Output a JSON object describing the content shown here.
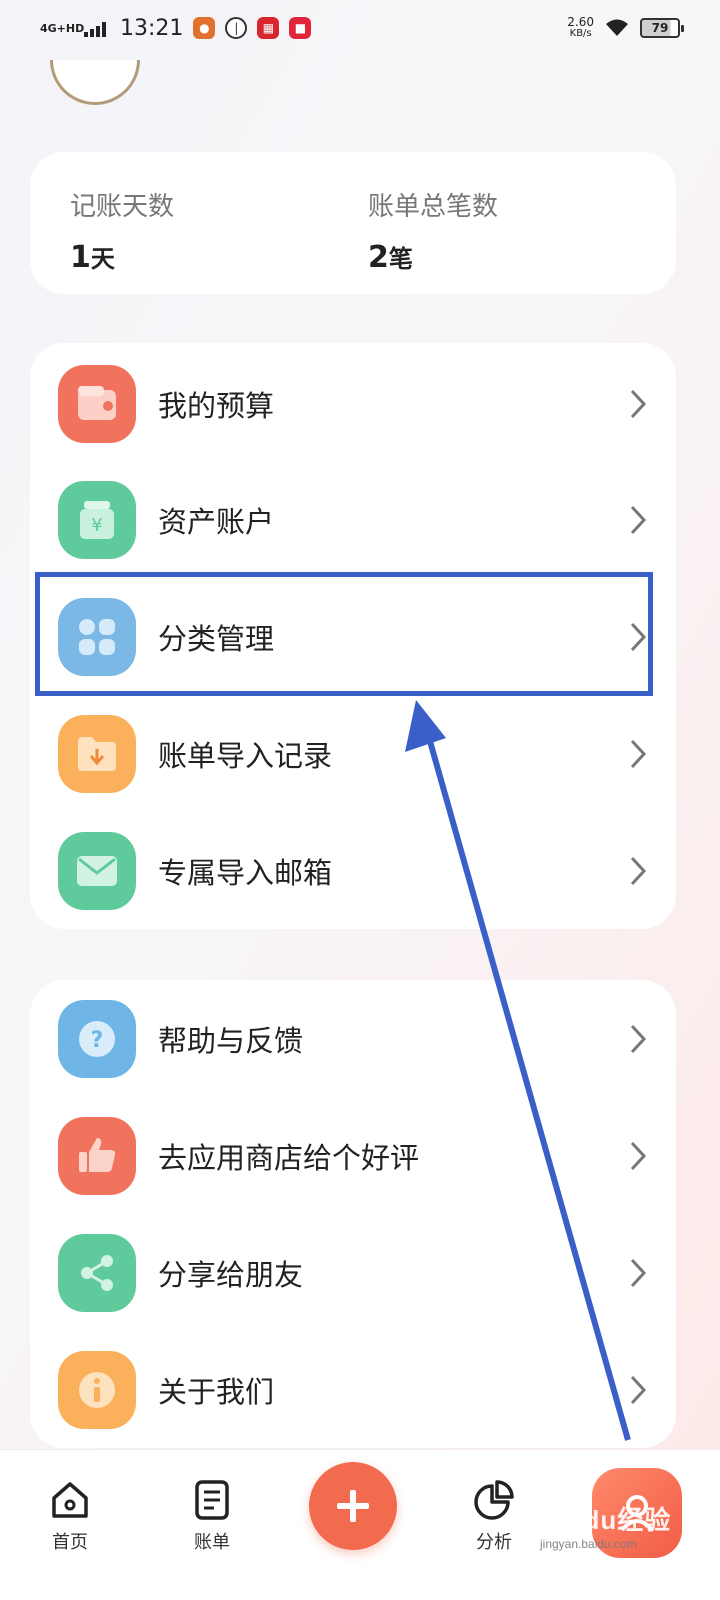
{
  "status_bar": {
    "network": "4G+HD",
    "time": "13:21",
    "speed_value": "2.60",
    "speed_unit": "KB/s",
    "battery": "79"
  },
  "stats": [
    {
      "label": "记账天数",
      "value": "1",
      "unit": "天"
    },
    {
      "label": "账单总笔数",
      "value": "2",
      "unit": "笔"
    }
  ],
  "menu1": [
    {
      "label": "我的预算",
      "icon": "wallet-icon",
      "color": "#f2735d"
    },
    {
      "label": "资产账户",
      "icon": "yuan-bag-icon",
      "color": "#5fcb9c"
    },
    {
      "label": "分类管理",
      "icon": "category-grid-icon",
      "color": "#7bb8e6"
    },
    {
      "label": "账单导入记录",
      "icon": "import-folder-icon",
      "color": "#fbb15c"
    },
    {
      "label": "专属导入邮箱",
      "icon": "mail-icon",
      "color": "#5fcb9c"
    }
  ],
  "menu2": [
    {
      "label": "帮助与反馈",
      "icon": "help-icon",
      "color": "#6fb6e6"
    },
    {
      "label": "去应用商店给个好评",
      "icon": "thumbs-up-icon",
      "color": "#f2735d"
    },
    {
      "label": "分享给朋友",
      "icon": "share-icon",
      "color": "#5fcb9c"
    },
    {
      "label": "关于我们",
      "icon": "info-icon",
      "color": "#fbb15c"
    }
  ],
  "bottom_nav": {
    "home": "首页",
    "bills": "账单",
    "analysis": "分析"
  },
  "watermark": {
    "brand": "Baidu经验",
    "url": "jingyan.baidu.com"
  },
  "colors": {
    "accent": "#f26b4f",
    "highlight": "#3b5fc8"
  }
}
